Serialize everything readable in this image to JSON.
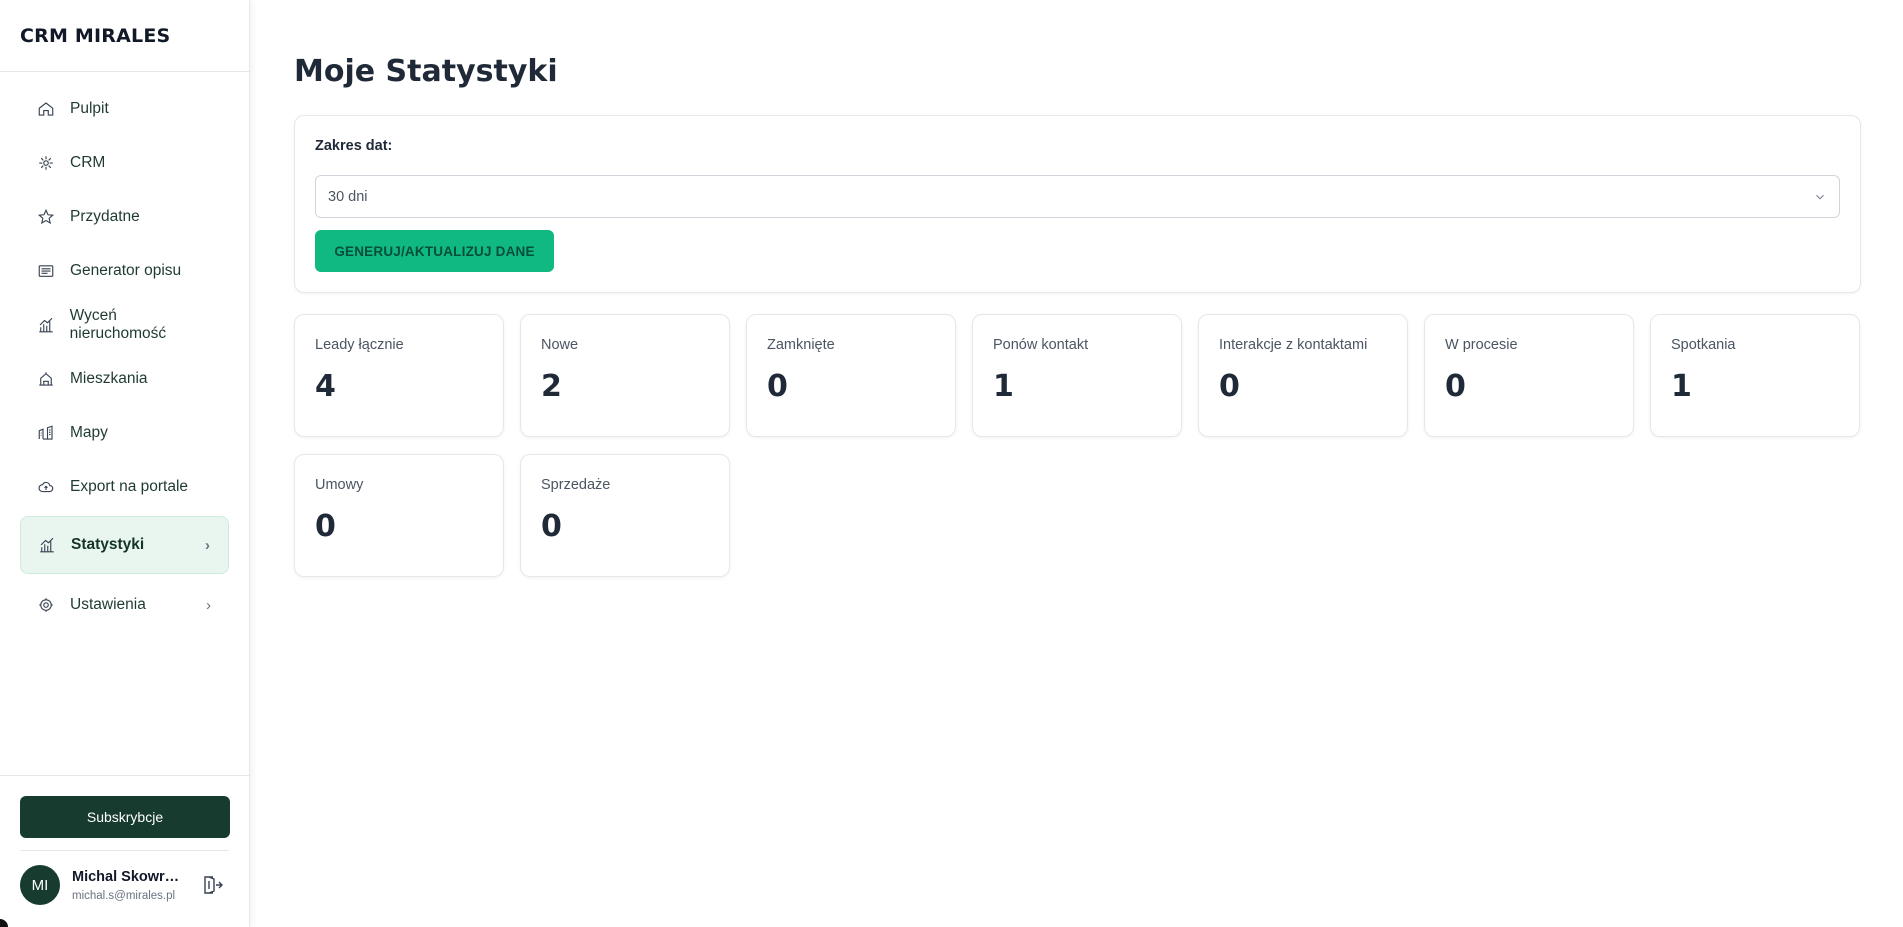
{
  "app": {
    "brand": "CRM MIRALES"
  },
  "sidebar": {
    "items": [
      {
        "label": "Pulpit",
        "icon": "home-icon"
      },
      {
        "label": "CRM",
        "icon": "crm-icon"
      },
      {
        "label": "Przydatne",
        "icon": "star-icon"
      },
      {
        "label": "Generator opisu",
        "icon": "document-icon"
      },
      {
        "label": "Wyceń nieruchomość",
        "icon": "chart-icon"
      },
      {
        "label": "Mieszkania",
        "icon": "building-icon"
      },
      {
        "label": "Mapy",
        "icon": "map-icon"
      },
      {
        "label": "Export na portale",
        "icon": "cloud-icon"
      },
      {
        "label": "Statystyki",
        "icon": "stats-icon",
        "active": true,
        "chevron": "›"
      },
      {
        "label": "Ustawienia",
        "icon": "settings-icon",
        "chevron": "›"
      }
    ],
    "subscribe_label": "Subskrybcje",
    "user": {
      "initials": "MI",
      "name": "Michal Skowro...",
      "email": "michal.s@mirales.pl"
    }
  },
  "main": {
    "title": "Moje Statystyki",
    "filter": {
      "label": "Zakres dat:",
      "selected": "30 dni",
      "button_label": "GENERUJ/AKTUALIZUJ DANE"
    },
    "stats": [
      {
        "label": "Leady łącznie",
        "value": "4"
      },
      {
        "label": "Nowe",
        "value": "2"
      },
      {
        "label": "Zamknięte",
        "value": "0"
      },
      {
        "label": "Ponów kontakt",
        "value": "1"
      },
      {
        "label": "Interakcje z kontaktami",
        "value": "0"
      },
      {
        "label": "W procesie",
        "value": "0"
      },
      {
        "label": "Spotkania",
        "value": "1"
      },
      {
        "label": "Umowy",
        "value": "0"
      },
      {
        "label": "Sprzedaże",
        "value": "0"
      }
    ]
  },
  "colors": {
    "accent": "#10b981",
    "brand_dark": "#173c2f",
    "active_bg": "#e8f6ef"
  }
}
